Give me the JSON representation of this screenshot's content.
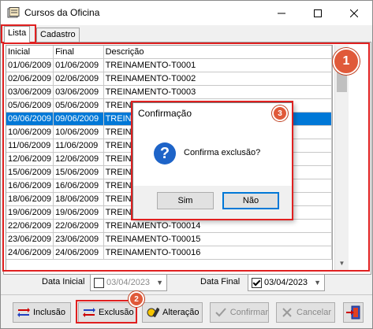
{
  "window": {
    "title": "Cursos da Oficina"
  },
  "tabs": [
    {
      "label": "Lista"
    },
    {
      "label": "Cadastro"
    }
  ],
  "grid": {
    "columns": [
      "Inicial",
      "Final",
      "Descrição"
    ],
    "rows": [
      [
        "01/06/2009",
        "01/06/2009",
        "TREINAMENTO-T0001"
      ],
      [
        "02/06/2009",
        "02/06/2009",
        "TREINAMENTO-T0002"
      ],
      [
        "03/06/2009",
        "03/06/2009",
        "TREINAMENTO-T0003"
      ],
      [
        "05/06/2009",
        "05/06/2009",
        "TREINAMENTO-T0004"
      ],
      [
        "09/06/2009",
        "09/06/2009",
        "TREINAMENTO-T0005"
      ],
      [
        "10/06/2009",
        "10/06/2009",
        "TREINAMENTO-T0006"
      ],
      [
        "11/06/2009",
        "11/06/2009",
        "TREINAMENTO-T0007"
      ],
      [
        "12/06/2009",
        "12/06/2009",
        "TREINAMENTO-T0008"
      ],
      [
        "15/06/2009",
        "15/06/2009",
        "TREINAMENTO-T0009"
      ],
      [
        "16/06/2009",
        "16/06/2009",
        "TREINAMENTO-T0010"
      ],
      [
        "18/06/2009",
        "18/06/2009",
        "TREINAMENTO-T0011"
      ],
      [
        "19/06/2009",
        "19/06/2009",
        "TREINAMENTO-T0012"
      ],
      [
        "22/06/2009",
        "22/06/2009",
        "TREINAMENTO-T00014"
      ],
      [
        "23/06/2009",
        "23/06/2009",
        "TREINAMENTO-T00015"
      ],
      [
        "24/06/2009",
        "24/06/2009",
        "TREINAMENTO-T00016"
      ]
    ],
    "selected_index": 4
  },
  "filters": {
    "start_label": "Data Inicial",
    "start_value": "03/04/2023",
    "start_checked": false,
    "end_label": "Data Final",
    "end_value": "03/04/2023",
    "end_checked": true
  },
  "toolbar": {
    "insert_label": "Inclusão",
    "delete_label": "Exclusão",
    "edit_label": "Alteração",
    "confirm_label": "Confirmar",
    "cancel_label": "Cancelar"
  },
  "dialog": {
    "title": "Confirmação",
    "message": "Confirma exclusão?",
    "yes_label": "Sim",
    "no_label": "Não"
  },
  "annotations": [
    "1",
    "2",
    "3"
  ],
  "colors": {
    "selection": "#0078d7",
    "annotation": "#e02020",
    "badge": "#e05a3a"
  }
}
